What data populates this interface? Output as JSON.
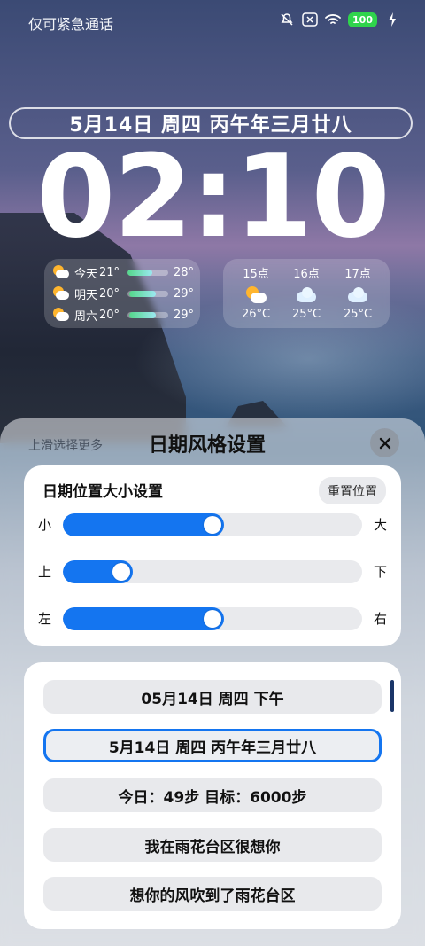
{
  "status_bar": {
    "carrier_text": "仅可紧急通话",
    "battery": "100",
    "icons": [
      "mute-bell-icon",
      "no-sim-icon",
      "wifi-icon",
      "battery-icon",
      "charging-icon"
    ]
  },
  "lockscreen": {
    "date_line": "5月14日 周四 丙午年三月廿八",
    "time": "02:10"
  },
  "weather": {
    "days": [
      {
        "day": "今天",
        "low": "21°",
        "high": "28°",
        "range": [
          0.0,
          0.6
        ],
        "icon": "partly-sunny-icon"
      },
      {
        "day": "明天",
        "low": "20°",
        "high": "29°",
        "range": [
          0.05,
          0.7
        ],
        "icon": "partly-sunny-icon"
      },
      {
        "day": "周六",
        "low": "20°",
        "high": "29°",
        "range": [
          0.05,
          0.7
        ],
        "icon": "partly-sunny-icon"
      }
    ],
    "hours": [
      {
        "time": "15点",
        "temp": "26°C",
        "icon": "partly-sunny-icon"
      },
      {
        "time": "16点",
        "temp": "25°C",
        "icon": "cloudy-icon"
      },
      {
        "time": "17点",
        "temp": "25°C",
        "icon": "cloudy-icon"
      }
    ]
  },
  "sheet": {
    "hint": "上滑选择更多",
    "title": "日期风格设置",
    "size_card": {
      "title": "日期位置大小设置",
      "reset_label": "重置位置",
      "sliders": [
        {
          "min_label": "小",
          "max_label": "大",
          "value": 0.5
        },
        {
          "min_label": "上",
          "max_label": "下",
          "value": 0.17
        },
        {
          "min_label": "左",
          "max_label": "右",
          "value": 0.5
        }
      ]
    },
    "options": [
      {
        "label": "05月14日 周四 下午",
        "selected": false
      },
      {
        "label": "5月14日 周四 丙午年三月廿八",
        "selected": true
      },
      {
        "label": "今日：49步  目标：6000步",
        "selected": false
      },
      {
        "label": "我在雨花台区很想你",
        "selected": false
      },
      {
        "label": "想你的风吹到了雨花台区",
        "selected": false
      }
    ]
  },
  "colors": {
    "accent": "#1475f0",
    "battery": "#2fd44c"
  }
}
